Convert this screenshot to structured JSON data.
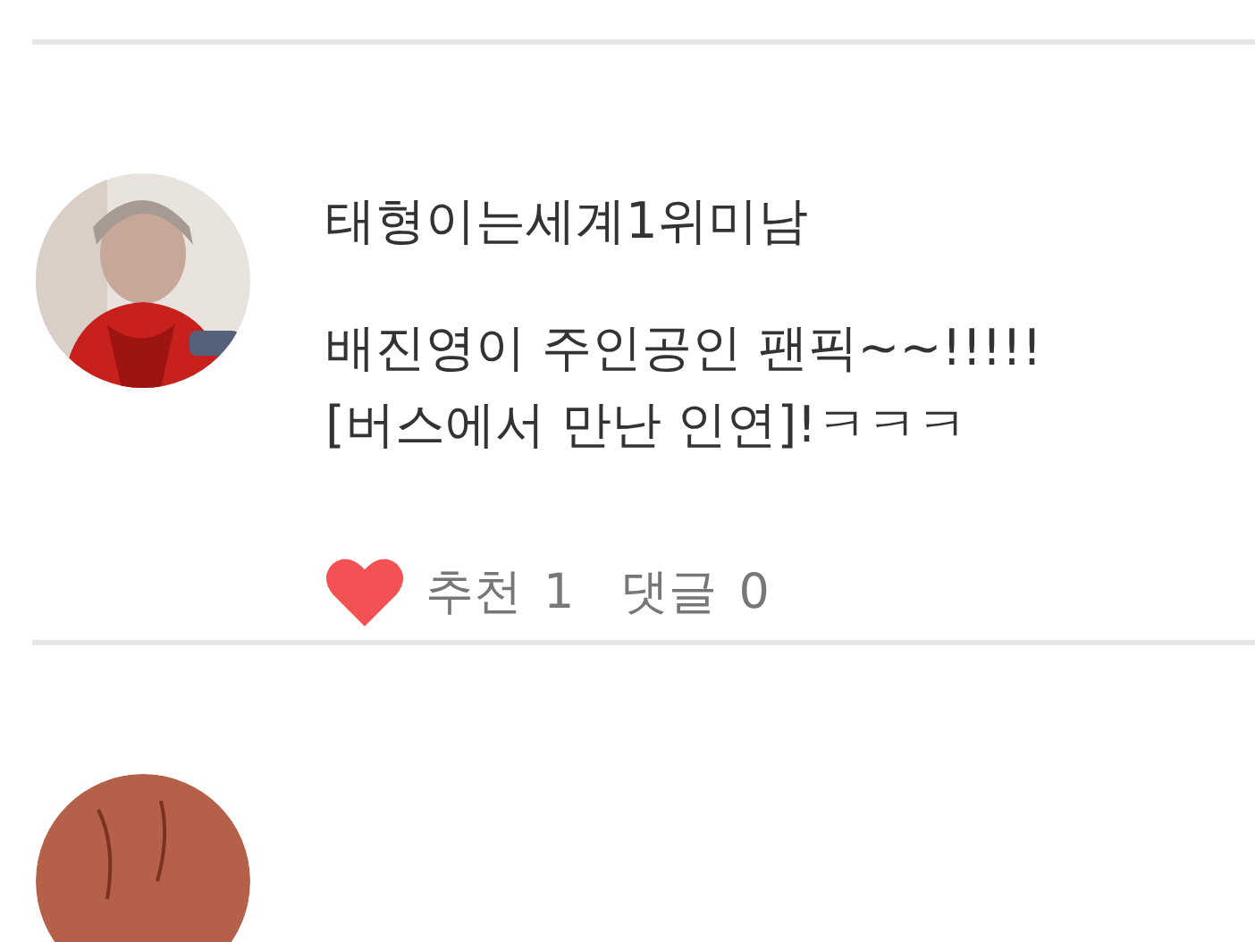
{
  "posts": [
    {
      "avatar": {
        "kind": "picture"
      },
      "author": "태형이는세계1위미남",
      "lines": [
        "배진영이 주인공인 팬픽~~!!!!!",
        "[버스에서 만난 인연]!ㅋㅋㅋ"
      ],
      "liked": true,
      "recommend_label": "추천",
      "recommend_count": "1",
      "comment_label": "댓글",
      "comment_count": "0"
    },
    {
      "avatar": {
        "kind": "picture"
      }
    }
  ]
}
